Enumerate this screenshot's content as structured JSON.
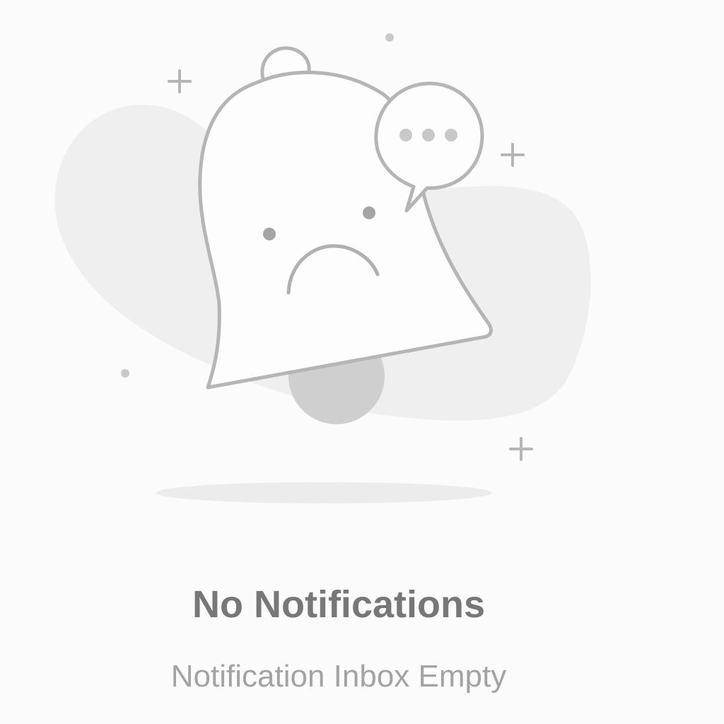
{
  "empty_state": {
    "title": "No Notifications",
    "subtitle": "Notification Inbox Empty",
    "illustration": "sad-bell-with-chat-bubble",
    "colors": {
      "background": "#fbfbfb",
      "blob": "#efefef",
      "outline": "#b5b5b5",
      "title": "#777777",
      "subtitle": "#a3a3a3"
    }
  }
}
